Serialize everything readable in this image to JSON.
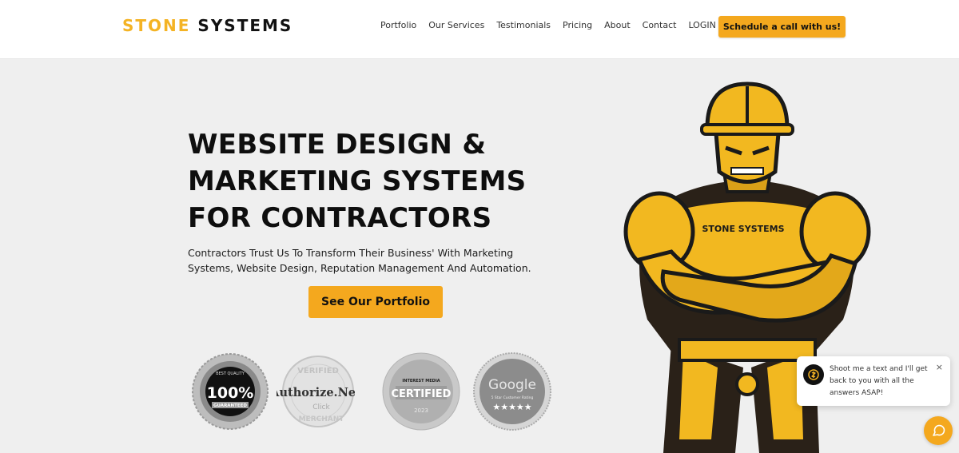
{
  "brand": {
    "part1": "STONE",
    "part2": "SYSTEMS",
    "accent": "#f4b324"
  },
  "nav": [
    {
      "label": "Portfolio"
    },
    {
      "label": "Our Services"
    },
    {
      "label": "Testimonials"
    },
    {
      "label": "Pricing"
    },
    {
      "label": "About"
    },
    {
      "label": "Contact"
    },
    {
      "label": "LOGIN"
    }
  ],
  "header_cta": "Schedule a call with us!",
  "hero": {
    "title_lines": [
      "WEBSITE DESIGN &",
      "MARKETING SYSTEMS",
      "FOR CONTRACTORS"
    ],
    "subtitle_lines": [
      "Contractors Trust Us To Transform Their Business' With Marketing",
      "Systems, Website Design, Reputation Management And Automation."
    ],
    "cta": "See Our Portfolio"
  },
  "badges": [
    {
      "icon": "guarantee-seal",
      "top": "BEST QUALITY",
      "main": "100%",
      "bottom": "GUARANTEED"
    },
    {
      "icon": "authorize-net-seal",
      "top": "VERIFIED",
      "main": "Authorize.Net",
      "sub": "Click",
      "bottom": "MERCHANT"
    },
    {
      "icon": "interest-media-seal",
      "top": "INTEREST MEDIA",
      "main": "CERTIFIED",
      "bottom": "2023"
    },
    {
      "icon": "google-seal",
      "main": "Google",
      "sub": "5 Star Customer Rating",
      "stars": "★★★★★"
    }
  ],
  "mascot": {
    "chest_text": "STONE SYSTEMS"
  },
  "chat": {
    "lines": [
      "Shoot me a text and I'll get",
      "back to you with all the",
      "answers ASAP!"
    ],
    "close": "×"
  },
  "colors": {
    "accent": "#f4a81e",
    "background": "#efefef"
  }
}
